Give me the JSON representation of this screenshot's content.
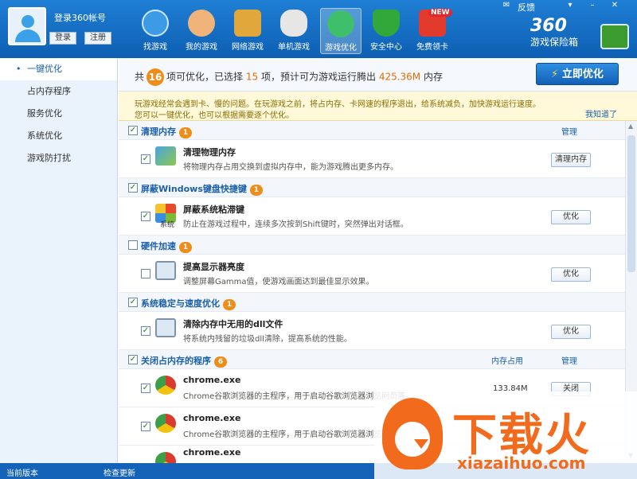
{
  "header": {
    "login_label": "登录360帐号",
    "login_button": "登录",
    "register_button": "注册",
    "feedback": "反馈",
    "nav": [
      {
        "label": "找游戏",
        "icon": "find-game-icon"
      },
      {
        "label": "我的游戏",
        "icon": "my-game-icon"
      },
      {
        "label": "网络游戏",
        "icon": "online-game-icon"
      },
      {
        "label": "单机游戏",
        "icon": "gamepad-icon"
      },
      {
        "label": "游戏优化",
        "icon": "optimize-icon"
      },
      {
        "label": "安全中心",
        "icon": "shield-icon"
      },
      {
        "label": "免费领卡",
        "icon": "gift-icon"
      }
    ],
    "new_badge": "NEW",
    "logo_main": "360",
    "logo_sub": "游戏保险箱"
  },
  "sidebar": {
    "items": [
      "一键优化",
      "占内存程序",
      "服务优化",
      "系统优化",
      "游戏防打扰"
    ]
  },
  "summary": {
    "prefix": "共",
    "total": "16",
    "mid1": "项可优化，已选择",
    "selected": "15",
    "mid2": "项，预计可为游戏运行腾出",
    "memory": "425.36M",
    "suffix": "内存",
    "optimize_button": "立即优化"
  },
  "notice": {
    "line1": "玩游戏经常会遇到卡、慢的问题。在玩游戏之前，将占内存、卡网速的程序退出，给系统减负，加快游戏运行速度。",
    "line2": "您可以一键优化，也可以根据需要逐个优化。",
    "dismiss": "我知道了"
  },
  "columns": {
    "manage": "管理",
    "memory": "内存占用"
  },
  "sections": [
    {
      "title": "清理内存",
      "count": "1",
      "checked": true,
      "rows": [
        {
          "title": "清理物理内存",
          "desc": "将物理内存占用交换到虚拟内存中，能为游戏腾出更多内存。",
          "button": "清理内存",
          "checked": true
        }
      ]
    },
    {
      "title": "屏蔽Windows键盘快捷键",
      "count": "1",
      "checked": true,
      "rows": [
        {
          "title": "屏蔽系统粘滞键",
          "desc": "防止在游戏过程中，连续多次按到Shift键时，突然弹出对话框。",
          "button": "优化",
          "checked": true,
          "icon_label": "系统"
        }
      ]
    },
    {
      "title": "硬件加速",
      "count": "1",
      "checked": false,
      "rows": [
        {
          "title": "提高显示器亮度",
          "desc": "调整屏幕Gamma值，使游戏画面达到最佳显示效果。",
          "button": "优化",
          "checked": false
        }
      ]
    },
    {
      "title": "系统稳定与速度优化",
      "count": "1",
      "checked": true,
      "rows": [
        {
          "title": "清除内存中无用的dll文件",
          "desc": "将系统内残留的垃圾dll清除，提高系统的性能。",
          "button": "优化",
          "checked": true
        }
      ]
    },
    {
      "title": "关闭占内存的程序",
      "count": "6",
      "checked": true,
      "rows": [
        {
          "title": "chrome.exe",
          "desc": "Chrome谷歌浏览器的主程序，用于启动谷歌浏览器浏览网页等。",
          "memory": "133.84M",
          "button": "关闭",
          "checked": true
        },
        {
          "title": "chrome.exe",
          "desc": "Chrome谷歌浏览器的主程序，用于启动谷歌浏览器浏览网页等。",
          "memory": "",
          "button": "",
          "checked": true
        },
        {
          "title": "chrome.exe",
          "desc": "",
          "memory": "",
          "button": "",
          "checked": true
        }
      ]
    }
  ],
  "footer": {
    "version": "当前版本",
    "update": "检查更新"
  },
  "watermark": {
    "cn": "下载火",
    "en": "xiazaihuo.com"
  },
  "colors": {
    "primary": "#1463b8",
    "accent": "#ef8d1b",
    "notice_bg": "#fff9d9"
  }
}
